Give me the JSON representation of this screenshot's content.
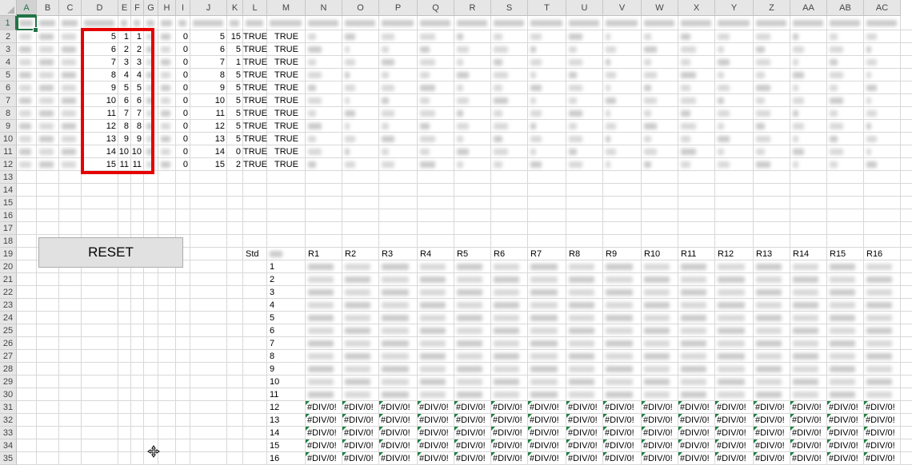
{
  "columns": [
    "A",
    "B",
    "C",
    "D",
    "E",
    "F",
    "G",
    "H",
    "I",
    "J",
    "K",
    "L",
    "M",
    "N",
    "O",
    "P",
    "Q",
    "R",
    "S",
    "T",
    "U",
    "V",
    "W",
    "X",
    "Y",
    "Z",
    "AA",
    "AB",
    "AC"
  ],
  "rows": [
    "1",
    "2",
    "3",
    "4",
    "5",
    "6",
    "7",
    "8",
    "9",
    "10",
    "11",
    "12",
    "13",
    "14",
    "15",
    "16",
    "17",
    "18",
    "19",
    "20",
    "21",
    "22",
    "23",
    "24",
    "25",
    "26",
    "27",
    "28",
    "29",
    "30",
    "31",
    "32",
    "33",
    "34",
    "35"
  ],
  "col_d": [
    "5",
    "6",
    "7",
    "8",
    "9",
    "10",
    "11",
    "12",
    "13",
    "14",
    "15"
  ],
  "col_e": [
    "1",
    "2",
    "3",
    "4",
    "5",
    "6",
    "7",
    "8",
    "9",
    "10",
    "11"
  ],
  "col_f": [
    "1",
    "2",
    "3",
    "4",
    "5",
    "6",
    "7",
    "8",
    "9",
    "10",
    "11"
  ],
  "col_i": [
    "0",
    "0",
    "0",
    "0",
    "0",
    "0",
    "0",
    "0",
    "0",
    "0",
    "0"
  ],
  "col_j": [
    "5",
    "6",
    "7",
    "8",
    "9",
    "10",
    "11",
    "12",
    "13",
    "14",
    "15"
  ],
  "col_k": [
    "15",
    "5",
    "1",
    "5",
    "5",
    "5",
    "5",
    "5",
    "5",
    "0",
    "2"
  ],
  "col_l": [
    "TRUE",
    "TRUE",
    "TRUE",
    "TRUE",
    "TRUE",
    "TRUE",
    "TRUE",
    "TRUE",
    "TRUE",
    "TRUE",
    "TRUE"
  ],
  "col_m": [
    "TRUE",
    "TRUE",
    "TRUE",
    "TRUE",
    "TRUE",
    "TRUE",
    "TRUE",
    "TRUE",
    "TRUE",
    "TRUE",
    "TRUE"
  ],
  "std_label": "Std",
  "r_headers": [
    "R1",
    "R2",
    "R3",
    "R4",
    "R5",
    "R6",
    "R7",
    "R8",
    "R9",
    "R10",
    "R11",
    "R12",
    "R13",
    "R14",
    "R15",
    "R16"
  ],
  "index_values": [
    "1",
    "2",
    "3",
    "4",
    "5",
    "6",
    "7",
    "8",
    "9",
    "10",
    "11",
    "12",
    "13",
    "14",
    "15",
    "16"
  ],
  "error_value": "#DIV/0!",
  "reset_button": "RESET",
  "colors": {
    "selection": "#217346",
    "highlight_box": "#e60000",
    "error_marker": "#1e7f3c"
  },
  "icons": {
    "cursor": "move-cursor-icon"
  }
}
